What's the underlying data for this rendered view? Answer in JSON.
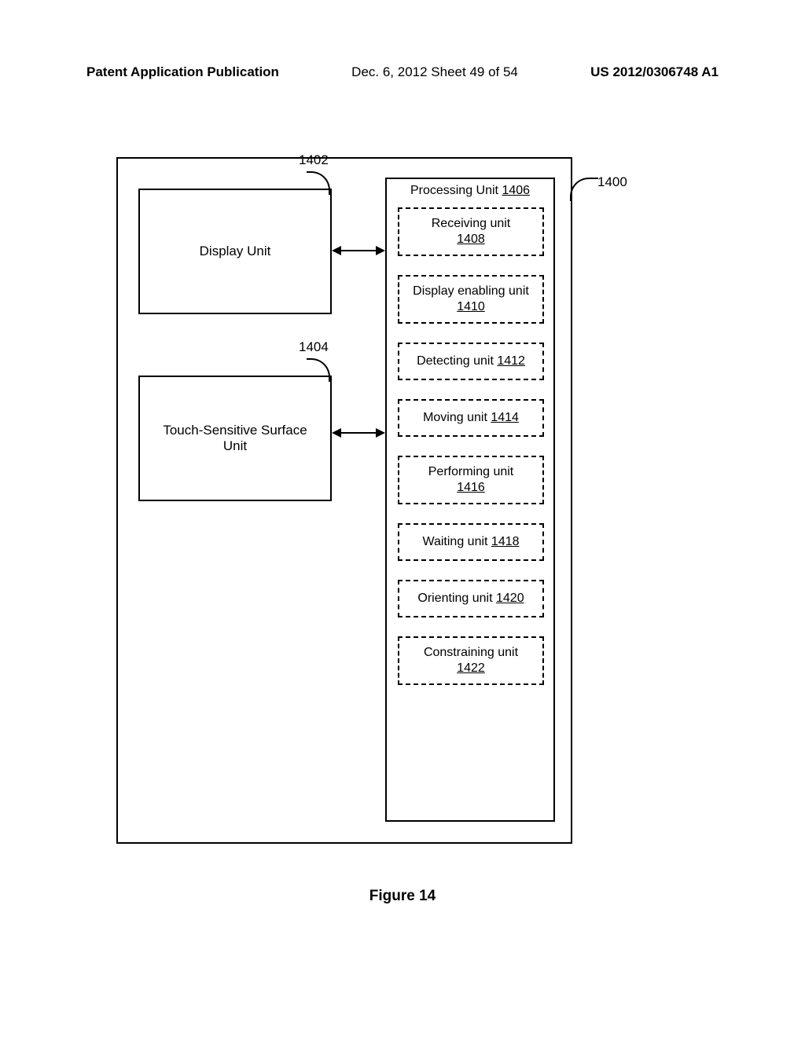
{
  "header": {
    "left": "Patent Application Publication",
    "center": "Dec. 6, 2012  Sheet 49 of 54",
    "right": "US 2012/0306748 A1"
  },
  "callouts": {
    "c1400": "1400",
    "c1402": "1402",
    "c1404": "1404"
  },
  "display_unit": "Display Unit",
  "touch_unit": "Touch-Sensitive Surface Unit",
  "processing_unit": {
    "label": "Processing Unit ",
    "num": "1406"
  },
  "subunits": [
    {
      "label": "Receiving unit",
      "num": "1408",
      "lines": 2
    },
    {
      "label": "Display enabling unit ",
      "num": "1410",
      "lines": 2
    },
    {
      "label": "Detecting unit ",
      "num": "1412",
      "lines": 1
    },
    {
      "label": "Moving unit ",
      "num": "1414",
      "lines": 1
    },
    {
      "label": "Performing unit",
      "num": "1416",
      "lines": 2
    },
    {
      "label": "Waiting unit ",
      "num": "1418",
      "lines": 1
    },
    {
      "label": "Orienting unit ",
      "num": "1420",
      "lines": 1
    },
    {
      "label": "Constraining unit",
      "num": "1422",
      "lines": 2
    }
  ],
  "figure_caption": "Figure 14"
}
